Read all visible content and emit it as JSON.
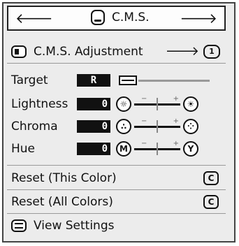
{
  "header": {
    "title": "C.M.S.",
    "prev_icon": "arrow-left",
    "next_icon": "arrow-right"
  },
  "adjustment": {
    "label": "C.M.S. Adjustment",
    "page_badge": "1"
  },
  "target": {
    "label": "Target",
    "value": "R"
  },
  "params": [
    {
      "label": "Lightness",
      "value": "0",
      "left_symbol": "sun-dim",
      "right_symbol": "sun-bright",
      "minus": "−",
      "plus": "+"
    },
    {
      "label": "Chroma",
      "value": "0",
      "left_symbol": "dots-dim",
      "right_symbol": "dots-bright",
      "minus": "−",
      "plus": "+"
    },
    {
      "label": "Hue",
      "value": "0",
      "left_letter": "M",
      "right_letter": "Y",
      "minus": "−",
      "plus": "+"
    }
  ],
  "reset_this": {
    "label": "Reset (This Color)",
    "badge": "C"
  },
  "reset_all": {
    "label": "Reset (All Colors)",
    "badge": "C"
  },
  "view_settings": {
    "label": "View Settings"
  }
}
